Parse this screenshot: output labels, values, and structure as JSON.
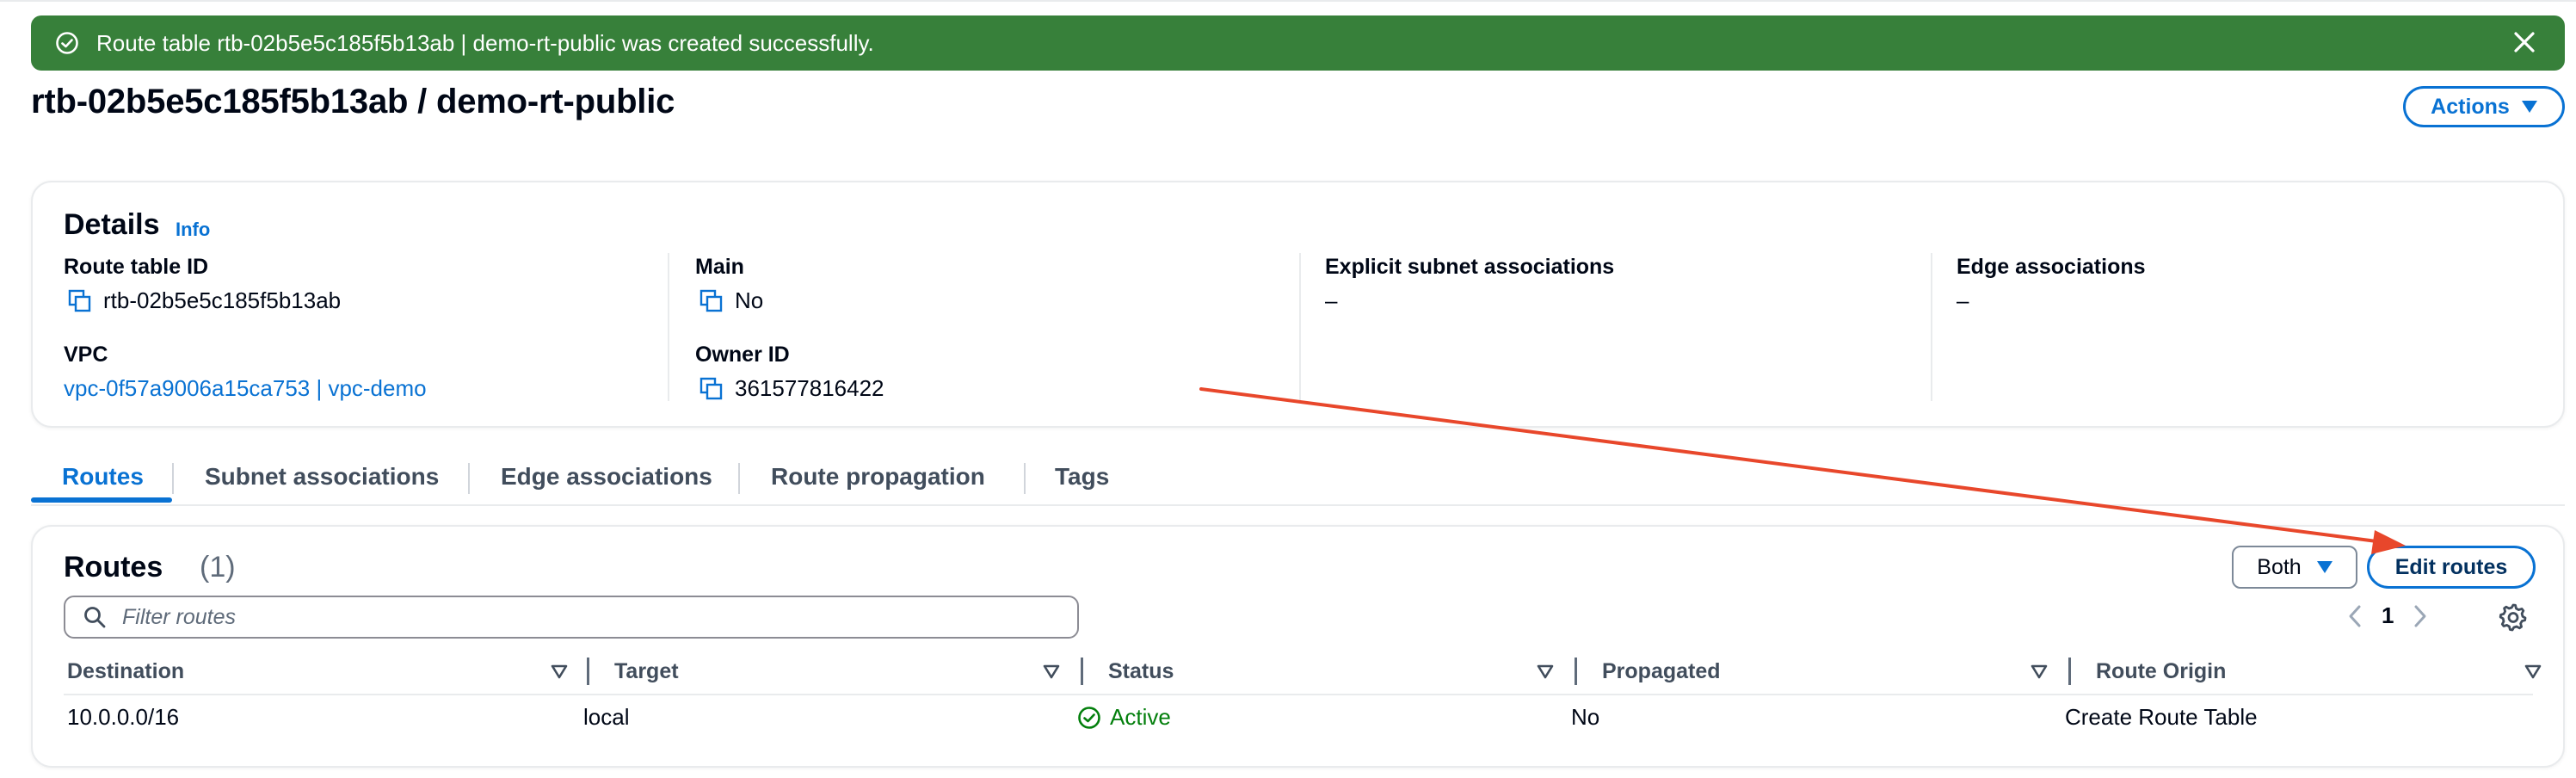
{
  "flash": {
    "message": "Route table rtb-02b5e5c185f5b13ab | demo-rt-public was created successfully.",
    "color": "#37803a"
  },
  "header": {
    "title": "rtb-02b5e5c185f5b13ab / demo-rt-public",
    "actions_label": "Actions"
  },
  "details": {
    "title": "Details",
    "info_label": "Info",
    "route_table_id_label": "Route table ID",
    "route_table_id": "rtb-02b5e5c185f5b13ab",
    "vpc_label": "VPC",
    "vpc": "vpc-0f57a9006a15ca753 | vpc-demo",
    "main_label": "Main",
    "main": "No",
    "owner_id_label": "Owner ID",
    "owner_id": "361577816422",
    "explicit_label": "Explicit subnet associations",
    "explicit": "–",
    "edge_label": "Edge associations",
    "edge": "–"
  },
  "tabs": [
    {
      "label": "Routes",
      "active": true
    },
    {
      "label": "Subnet associations",
      "active": false
    },
    {
      "label": "Edge associations",
      "active": false
    },
    {
      "label": "Route propagation",
      "active": false
    },
    {
      "label": "Tags",
      "active": false
    }
  ],
  "routes": {
    "title": "Routes",
    "count": "(1)",
    "filter_placeholder": "Filter routes",
    "ip_filter": "Both",
    "edit_label": "Edit routes",
    "page": "1",
    "columns": [
      "Destination",
      "Target",
      "Status",
      "Propagated",
      "Route Origin"
    ],
    "rows": [
      {
        "destination": "10.0.0.0/16",
        "target": "local",
        "status": "Active",
        "propagated": "No",
        "origin": "Create Route Table"
      }
    ]
  },
  "colors": {
    "accent": "#0972d3",
    "success": "#037f0c",
    "annotation_arrow": "#e8472b"
  }
}
